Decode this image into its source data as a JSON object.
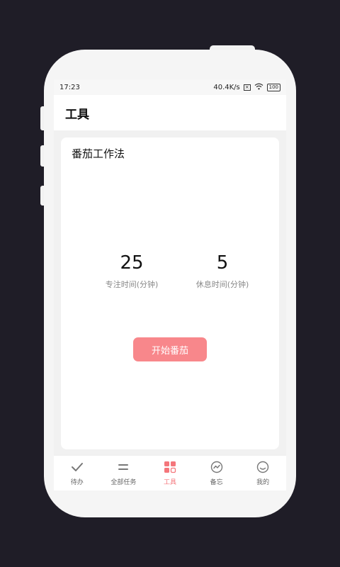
{
  "status_bar": {
    "time": "17:23",
    "network_speed": "40.4K/s",
    "sim_icon": "×",
    "battery": "100"
  },
  "app_bar": {
    "title": "工具"
  },
  "tool_card": {
    "title": "番茄工作法",
    "focus": {
      "value": "25",
      "label": "专注时间(分钟)"
    },
    "rest": {
      "value": "5",
      "label": "休息时间(分钟)"
    },
    "start_button": "开始番茄"
  },
  "bottom_nav": {
    "active_color": "#f4767b",
    "items": [
      {
        "label": "待办",
        "icon": "checkmark-icon"
      },
      {
        "label": "全部任务",
        "icon": "equals-icon"
      },
      {
        "label": "工具",
        "icon": "grid-icon",
        "active": true
      },
      {
        "label": "备忘",
        "icon": "chart-circle-icon"
      },
      {
        "label": "我的",
        "icon": "smiley-icon"
      }
    ]
  }
}
